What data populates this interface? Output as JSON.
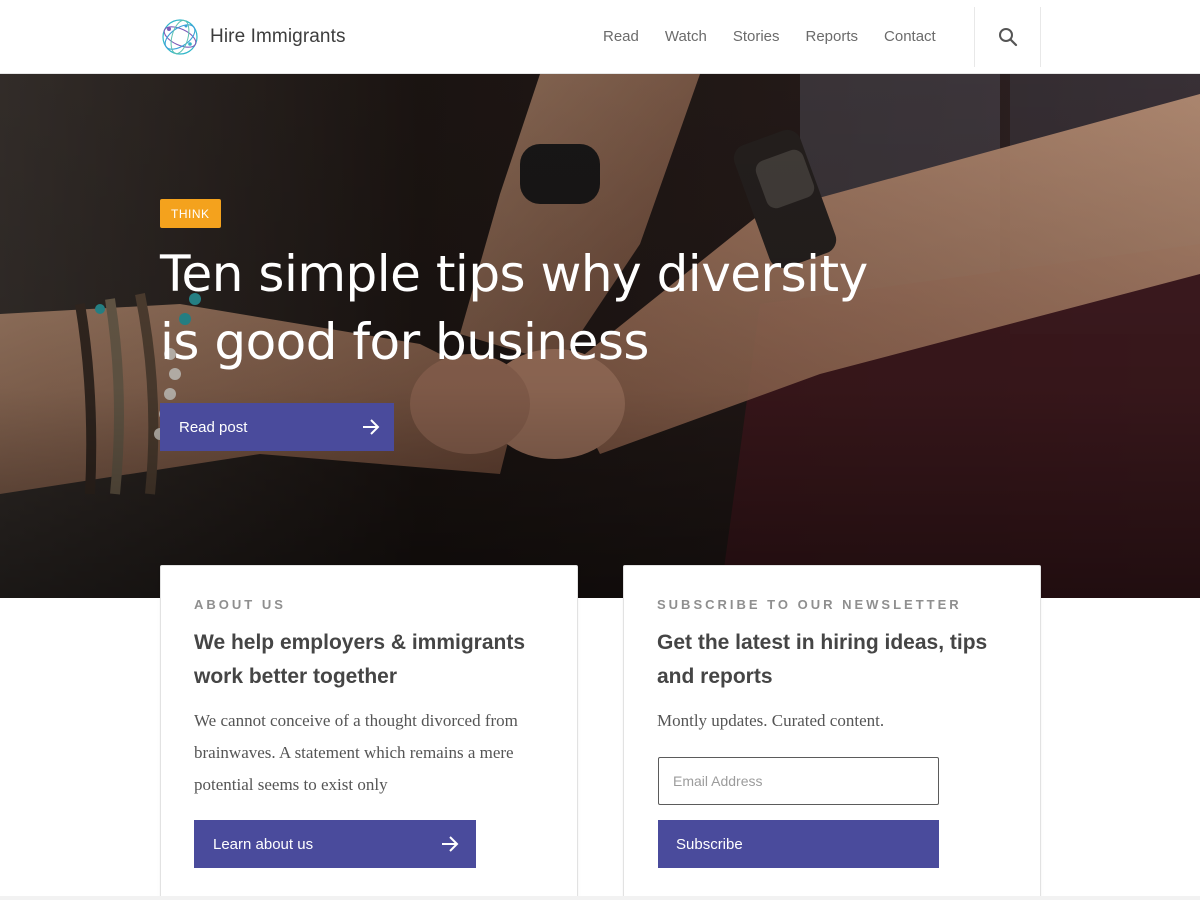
{
  "header": {
    "logo_text": "Hire Immigrants",
    "nav": [
      "Read",
      "Watch",
      "Stories",
      "Reports",
      "Contact"
    ],
    "search_icon": "search-icon"
  },
  "hero": {
    "tag": "THINK",
    "title": "Ten simple tips why diversity is good for business",
    "button_label": "Read post",
    "button_icon": "arrow-right-icon"
  },
  "about": {
    "eyebrow": "ABOUT US",
    "title": "We help employers & immigrants work better together",
    "body": "We cannot conceive of a thought divorced from brainwaves. A statement which remains a mere potential seems to exist only",
    "button_label": "Learn about us",
    "button_icon": "arrow-right-icon"
  },
  "newsletter": {
    "eyebrow": "SUBSCRIBE TO OUR NEWSLETTER",
    "title": "Get the latest in hiring ideas, tips and reports",
    "body": "Montly updates. Curated content.",
    "email_placeholder": "Email Address",
    "email_value": "",
    "button_label": "Subscribe"
  },
  "colors": {
    "accent": "#4a4b9c",
    "tag": "#f4a21d"
  }
}
